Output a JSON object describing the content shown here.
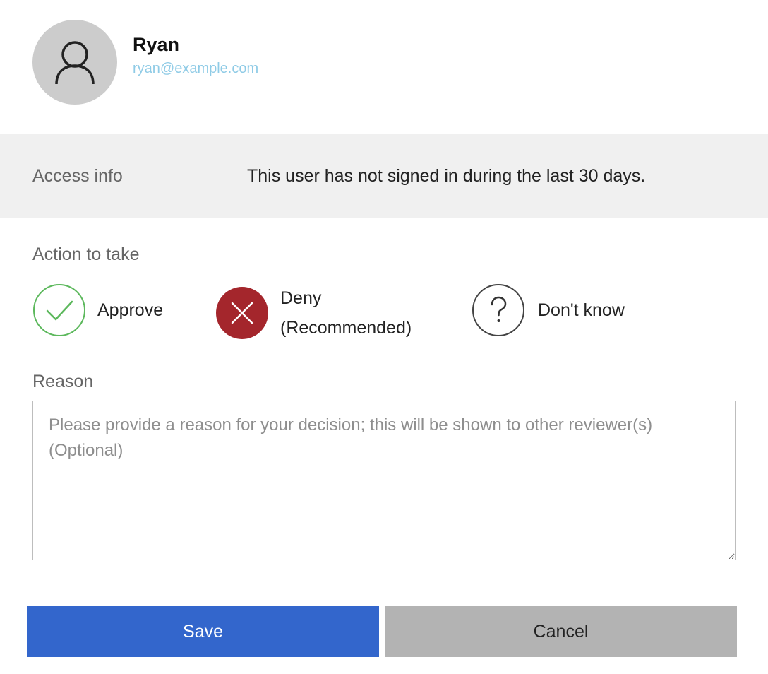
{
  "user": {
    "name": "Ryan",
    "email": "ryan@example.com",
    "avatar_icon": "person-icon"
  },
  "access_info": {
    "label": "Access info",
    "value": "This user has not signed in during the last 30 days."
  },
  "action": {
    "label": "Action to take",
    "options": [
      {
        "id": "approve",
        "label": "Approve",
        "icon": "check-circle-icon",
        "color": "#5cb85c"
      },
      {
        "id": "deny",
        "label_line1": "Deny",
        "label_line2": "(Recommended)",
        "icon": "x-circle-icon",
        "color": "#a4262c"
      },
      {
        "id": "dont_know",
        "label": "Don't know",
        "icon": "question-circle-icon",
        "color": "#444444"
      }
    ]
  },
  "reason": {
    "label": "Reason",
    "value": "",
    "placeholder": "Please provide a reason for your decision; this will be shown to other reviewer(s) (Optional)"
  },
  "buttons": {
    "save_label": "Save",
    "cancel_label": "Cancel",
    "save_color": "#3366cc",
    "cancel_color": "#b3b3b3"
  }
}
